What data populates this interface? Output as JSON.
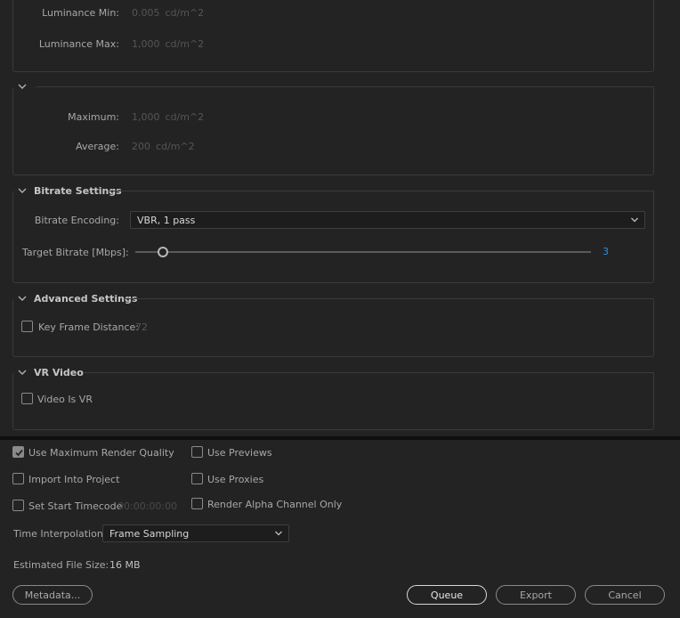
{
  "hdr": {
    "luminance_min_label": "Luminance Min:",
    "luminance_min_value": "0.005",
    "luminance_min_unit": "cd/m^2",
    "luminance_max_label": "Luminance Max:",
    "luminance_max_value": "1,000",
    "luminance_max_unit": "cd/m^2"
  },
  "content_light": {
    "maximum_label": "Maximum:",
    "maximum_value": "1,000",
    "maximum_unit": "cd/m^2",
    "average_label": "Average:",
    "average_value": "200",
    "average_unit": "cd/m^2"
  },
  "bitrate": {
    "title": "Bitrate Settings",
    "encoding_label": "Bitrate Encoding:",
    "encoding_value": "VBR, 1 pass",
    "target_label": "Target Bitrate [Mbps]:",
    "target_value": "3",
    "target_fraction": 0.06
  },
  "advanced": {
    "title": "Advanced Settings",
    "key_frame_label": "Key Frame Distance:",
    "key_frame_value": "72",
    "key_frame_checked": false
  },
  "vr": {
    "title": "VR Video",
    "video_is_vr_label": "Video Is VR",
    "video_is_vr_checked": false
  },
  "options": {
    "use_max_render_quality": "Use Maximum Render Quality",
    "use_max_render_quality_checked": true,
    "use_previews": "Use Previews",
    "import_into_project": "Import Into Project",
    "use_proxies": "Use Proxies",
    "set_start_timecode": "Set Start Timecode",
    "start_timecode_value": "00:00:00:00",
    "render_alpha_only": "Render Alpha Channel Only",
    "time_interpolation_label": "Time Interpolation:",
    "time_interpolation_value": "Frame Sampling",
    "estimated_file_size_label": "Estimated File Size:",
    "estimated_file_size_value": "16 MB"
  },
  "buttons": {
    "metadata": "Metadata...",
    "queue": "Queue",
    "export": "Export",
    "cancel": "Cancel"
  },
  "colors": {
    "background": "#232323",
    "accent": "#2d8ceb",
    "border": "#3a3a3a"
  }
}
